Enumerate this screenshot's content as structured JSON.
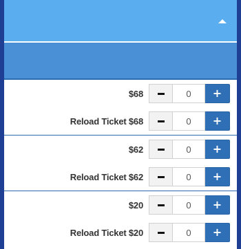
{
  "header": {
    "toggle_icon": "caret-up-icon"
  },
  "tickets": [
    {
      "rows": [
        {
          "label": "$68",
          "quantity": "0",
          "minus_icon": "minus-icon",
          "plus_icon": "+"
        },
        {
          "label": "Reload Ticket $68",
          "quantity": "0",
          "minus_icon": "minus-icon",
          "plus_icon": "+"
        }
      ]
    },
    {
      "rows": [
        {
          "label": "$62",
          "quantity": "0",
          "minus_icon": "minus-icon",
          "plus_icon": "+"
        },
        {
          "label": "Reload Ticket $62",
          "quantity": "0",
          "minus_icon": "minus-icon",
          "plus_icon": "+"
        }
      ]
    },
    {
      "rows": [
        {
          "label": "$20",
          "quantity": "0",
          "minus_icon": "minus-icon",
          "plus_icon": "+"
        },
        {
          "label": "Reload Ticket $20",
          "quantity": "0",
          "minus_icon": "minus-icon",
          "plus_icon": "+"
        }
      ]
    }
  ],
  "colors": {
    "page_background": "#1b3a8c",
    "top_bar": "#5aaef0",
    "sub_bar": "#4a90d6",
    "plus_button": "#2f6fb6",
    "divider": "#2a6bb0"
  }
}
